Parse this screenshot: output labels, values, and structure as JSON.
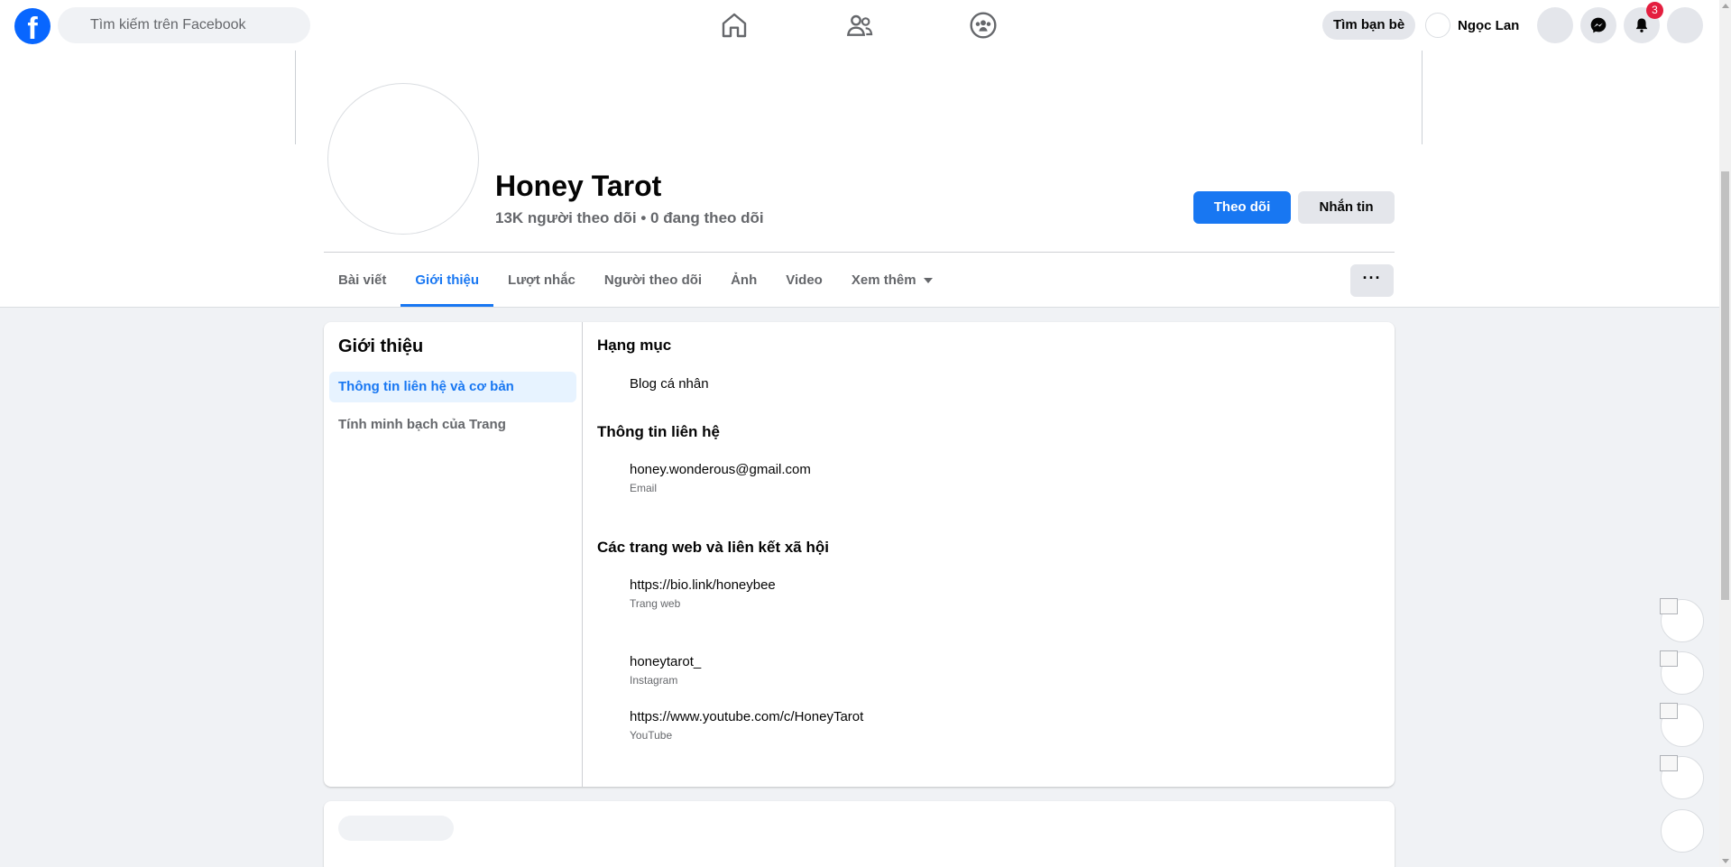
{
  "topbar": {
    "search_placeholder": "Tìm kiếm trên Facebook",
    "find_friends_label": "Tìm bạn bè",
    "profile_name": "Ngọc Lan",
    "notification_count": "3",
    "icons": [
      "facebook-logo",
      "home-icon",
      "friends-icon",
      "groups-icon",
      "menu-icon",
      "messenger-icon",
      "bell-icon",
      "account-icon"
    ]
  },
  "page": {
    "name": "Honey Tarot",
    "stats": "13K người theo dõi • 0 đang theo dõi",
    "follow_label": "Theo dõi",
    "message_label": "Nhắn tin"
  },
  "tabs": [
    {
      "label": "Bài viết"
    },
    {
      "label": "Giới thiệu",
      "active": true
    },
    {
      "label": "Lượt nhắc"
    },
    {
      "label": "Người theo dõi"
    },
    {
      "label": "Ảnh"
    },
    {
      "label": "Video"
    },
    {
      "label": "Xem thêm"
    }
  ],
  "more_button_label": "···",
  "about": {
    "title": "Giới thiệu",
    "side_items": [
      {
        "label": "Thông tin liên hệ và cơ bản",
        "active": true
      },
      {
        "label": "Tính minh bạch của Trang"
      }
    ],
    "category_title": "Hạng mục",
    "category_value": "Blog cá nhân",
    "contact_title": "Thông tin liên hệ",
    "email_value": "honey.wonderous@gmail.com",
    "email_label": "Email",
    "links_title": "Các trang web và liên kết xã hội",
    "links": [
      {
        "value": "https://bio.link/honeybee",
        "label": "Trang web"
      },
      {
        "value": "honeytarot_",
        "label": "Instagram"
      },
      {
        "value": "https://www.youtube.com/c/HoneyTarot",
        "label": "YouTube"
      }
    ]
  },
  "colors": {
    "accent": "#1877f2",
    "badge": "#e41e3f",
    "background": "#f0f2f5"
  }
}
